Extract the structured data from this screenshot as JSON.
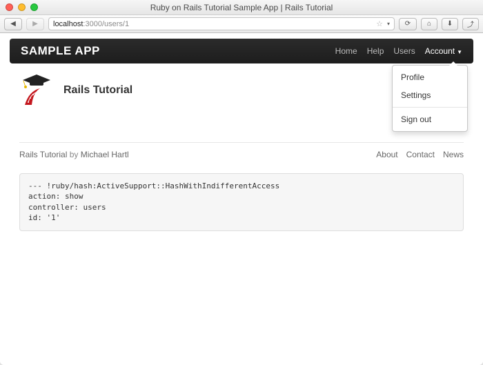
{
  "window": {
    "title": "Ruby on Rails Tutorial Sample App | Rails Tutorial"
  },
  "url": {
    "host": "localhost",
    "port": ":3000",
    "path": "/users/1"
  },
  "appbar": {
    "brand": "SAMPLE APP",
    "links": {
      "home": "Home",
      "help": "Help",
      "users": "Users",
      "account": "Account"
    }
  },
  "dropdown": {
    "profile": "Profile",
    "settings": "Settings",
    "signout": "Sign out"
  },
  "page": {
    "heading": "Rails Tutorial"
  },
  "footer": {
    "site": "Rails Tutorial",
    "by": " by ",
    "author": "Michael Hartl",
    "about": "About",
    "contact": "Contact",
    "news": "News"
  },
  "debug": "--- !ruby/hash:ActiveSupport::HashWithIndifferentAccess\naction: show\ncontroller: users\nid: '1'"
}
